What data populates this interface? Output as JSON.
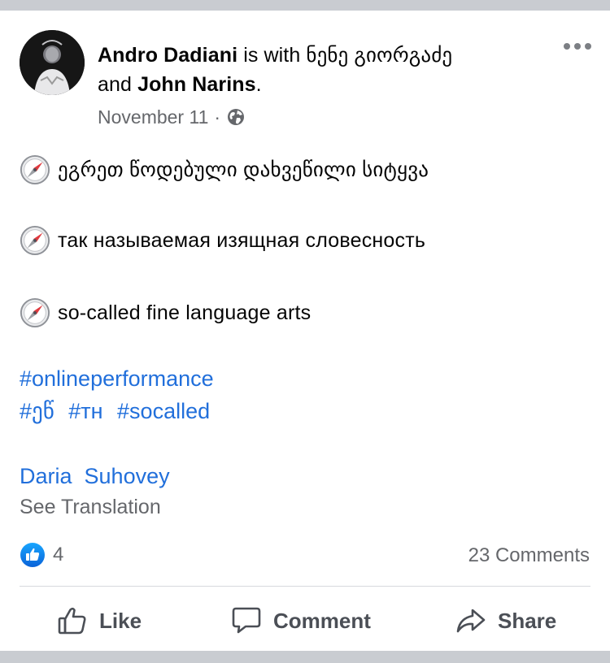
{
  "post": {
    "author": "Andro Dadiani",
    "with_text": "is with",
    "tagged_1": "ნენე გიორგაძე",
    "and_text": "and",
    "tagged_2": "John Narins",
    "period": ".",
    "date": "November 11",
    "separator": "·",
    "privacy_icon": "globe-icon",
    "more_icon": "more-options-icon",
    "lines": [
      "ეგრეთ წოდებული დახვეწილი სიტყვა",
      "так называемая изящная словесность",
      "so-called fine language arts"
    ],
    "line_icon": "compass-icon",
    "hashtags_line1": [
      "#onlineperformance"
    ],
    "hashtags_line2": [
      "#ეწ",
      "#тн",
      "#socalled"
    ],
    "mention": "Daria  Suhovey",
    "see_translation": "See Translation"
  },
  "reactions": {
    "icon": "like-reaction-icon",
    "count": "4",
    "comments": "23 Comments"
  },
  "actions": {
    "like": "Like",
    "comment": "Comment",
    "share": "Share"
  },
  "colors": {
    "link": "#216fdb",
    "secondary_text": "#65676b",
    "like_blue": "#1b74e4",
    "separator_bar": "#c9ccd1"
  }
}
